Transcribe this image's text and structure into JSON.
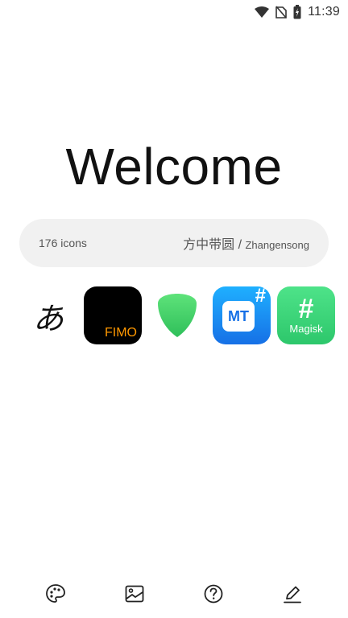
{
  "status_bar": {
    "time": "11:39",
    "icons": [
      "wifi-icon",
      "no-sim-icon",
      "battery-charging-icon"
    ]
  },
  "header": {
    "title": "Welcome"
  },
  "info": {
    "count_label": "176 icons",
    "pack_name": "方中带圆",
    "separator": " / ",
    "author": "Zhangensong"
  },
  "icons": [
    {
      "name": "hiragana-a-icon",
      "glyph": "あ"
    },
    {
      "name": "fimo-app-icon",
      "label": "FIMO",
      "bg": "#000000",
      "fg": "#ff9800"
    },
    {
      "name": "shield-app-icon",
      "bg": "#4cd964"
    },
    {
      "name": "mt-manager-app-icon",
      "label": "MT",
      "badge": "#",
      "bg": "#1e90ff"
    },
    {
      "name": "magisk-app-icon",
      "label": "Magisk",
      "glyph": "#",
      "bg": "#3ddc84"
    }
  ],
  "bottom_nav": [
    "palette-icon",
    "image-icon",
    "help-icon",
    "edit-icon"
  ]
}
